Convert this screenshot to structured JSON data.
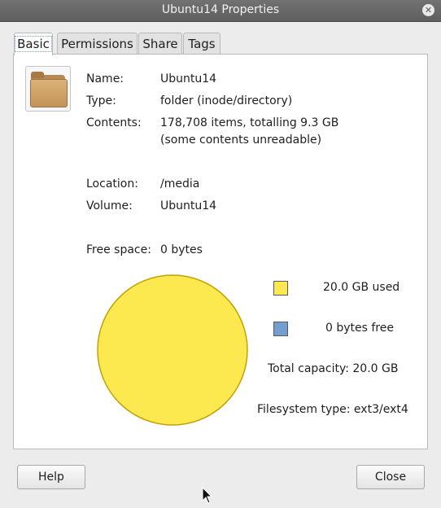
{
  "window": {
    "title": "Ubuntu14 Properties"
  },
  "tabs": [
    {
      "label": "Basic",
      "active": true
    },
    {
      "label": "Permissions",
      "active": false
    },
    {
      "label": "Share",
      "active": false
    },
    {
      "label": "Tags",
      "active": false
    }
  ],
  "basic": {
    "icon": "folder-icon",
    "name_label": "Name:",
    "name_value": "Ubuntu14",
    "type_label": "Type:",
    "type_value": "folder (inode/directory)",
    "contents_label": "Contents:",
    "contents_value": "178,708 items, totalling 9.3 GB",
    "contents_note": "(some contents unreadable)",
    "location_label": "Location:",
    "location_value": "/media",
    "volume_label": "Volume:",
    "volume_value": "Ubuntu14",
    "free_label": "Free space:",
    "free_value": "0 bytes"
  },
  "usage": {
    "used_text": "20.0 GB used",
    "free_text": "0 bytes free",
    "capacity_text": "Total capacity: 20.0 GB",
    "fs_text": "Filesystem type: ext3/ext4",
    "used_color": "#fce94f",
    "free_color": "#729fcf"
  },
  "chart_data": {
    "type": "pie",
    "slices": [
      {
        "label": "20.0 GB used",
        "value": 20.0,
        "color": "#fce94f"
      },
      {
        "label": "0 bytes free",
        "value": 0,
        "color": "#729fcf"
      }
    ]
  },
  "buttons": {
    "help_label": "Help",
    "close_label": "Close"
  }
}
